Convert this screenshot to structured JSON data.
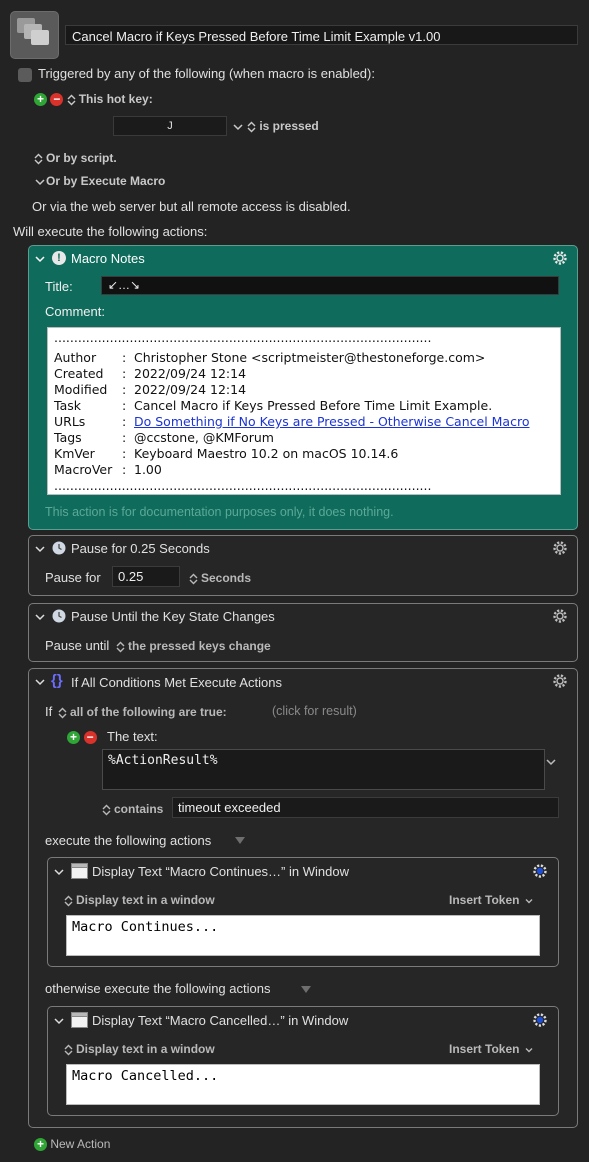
{
  "macro": {
    "name": "Cancel Macro if Keys Pressed Before Time Limit Example v1.00"
  },
  "triggers": {
    "header": "Triggered by any of the following (when macro is enabled):",
    "hotkey_label": "This hot key:",
    "hotkey_value": "J",
    "hotkey_mode": "is pressed",
    "by_script": "Or by script.",
    "by_execute_macro": "Or by Execute Macro",
    "web_server": "Or via the web server but all remote access is disabled."
  },
  "actions_header": "Will execute the following actions:",
  "notes_action": {
    "title": "Macro Notes",
    "title_label": "Title:",
    "title_value": "↙…↘",
    "comment_label": "Comment:",
    "dots": "...............................................................................................",
    "rows": [
      {
        "k": "Author",
        "v": "Christopher Stone <scriptmeister@thestoneforge.com>"
      },
      {
        "k": "Created",
        "v": "2022/09/24 12:14"
      },
      {
        "k": "Modified",
        "v": "2022/09/24 12:14"
      },
      {
        "k": "Task",
        "v": "Cancel Macro if Keys Pressed Before Time Limit Example."
      },
      {
        "k": "URLs",
        "v": "Do Something if No Keys are Pressed - Otherwise Cancel Macro"
      },
      {
        "k": "Tags",
        "v": "@ccstone, @KMForum"
      },
      {
        "k": "KmVer",
        "v": "Keyboard Maestro 10.2 on macOS 10.14.6"
      },
      {
        "k": "MacroVer",
        "v": "1.00"
      }
    ],
    "footer": "This action is for documentation purposes only, it does nothing."
  },
  "pause_action": {
    "title": "Pause for 0.25 Seconds",
    "label": "Pause for",
    "value": "0.25",
    "unit": "Seconds"
  },
  "pause_until_action": {
    "title": "Pause Until the Key State Changes",
    "label": "Pause until",
    "value": "the pressed keys change"
  },
  "if_action": {
    "title": "If All Conditions Met Execute Actions",
    "if_label": "If",
    "condition_mode": "all of the following are true:",
    "click_hint": "(click for result)",
    "text_label": "The text:",
    "text_value": "%ActionResult%",
    "contains_label": "contains",
    "contains_value": "timeout exceeded",
    "then_label": "execute the following actions",
    "else_label": "otherwise execute the following actions",
    "then_action": {
      "title": "Display Text “Macro Continues…” in Window",
      "mode": "Display text in a window",
      "insert_token": "Insert Token",
      "text": "Macro Continues..."
    },
    "else_action": {
      "title": "Display Text “Macro Cancelled…” in Window",
      "mode": "Display text in a window",
      "insert_token": "Insert Token",
      "text": "Macro Cancelled..."
    }
  },
  "new_action": "New Action"
}
